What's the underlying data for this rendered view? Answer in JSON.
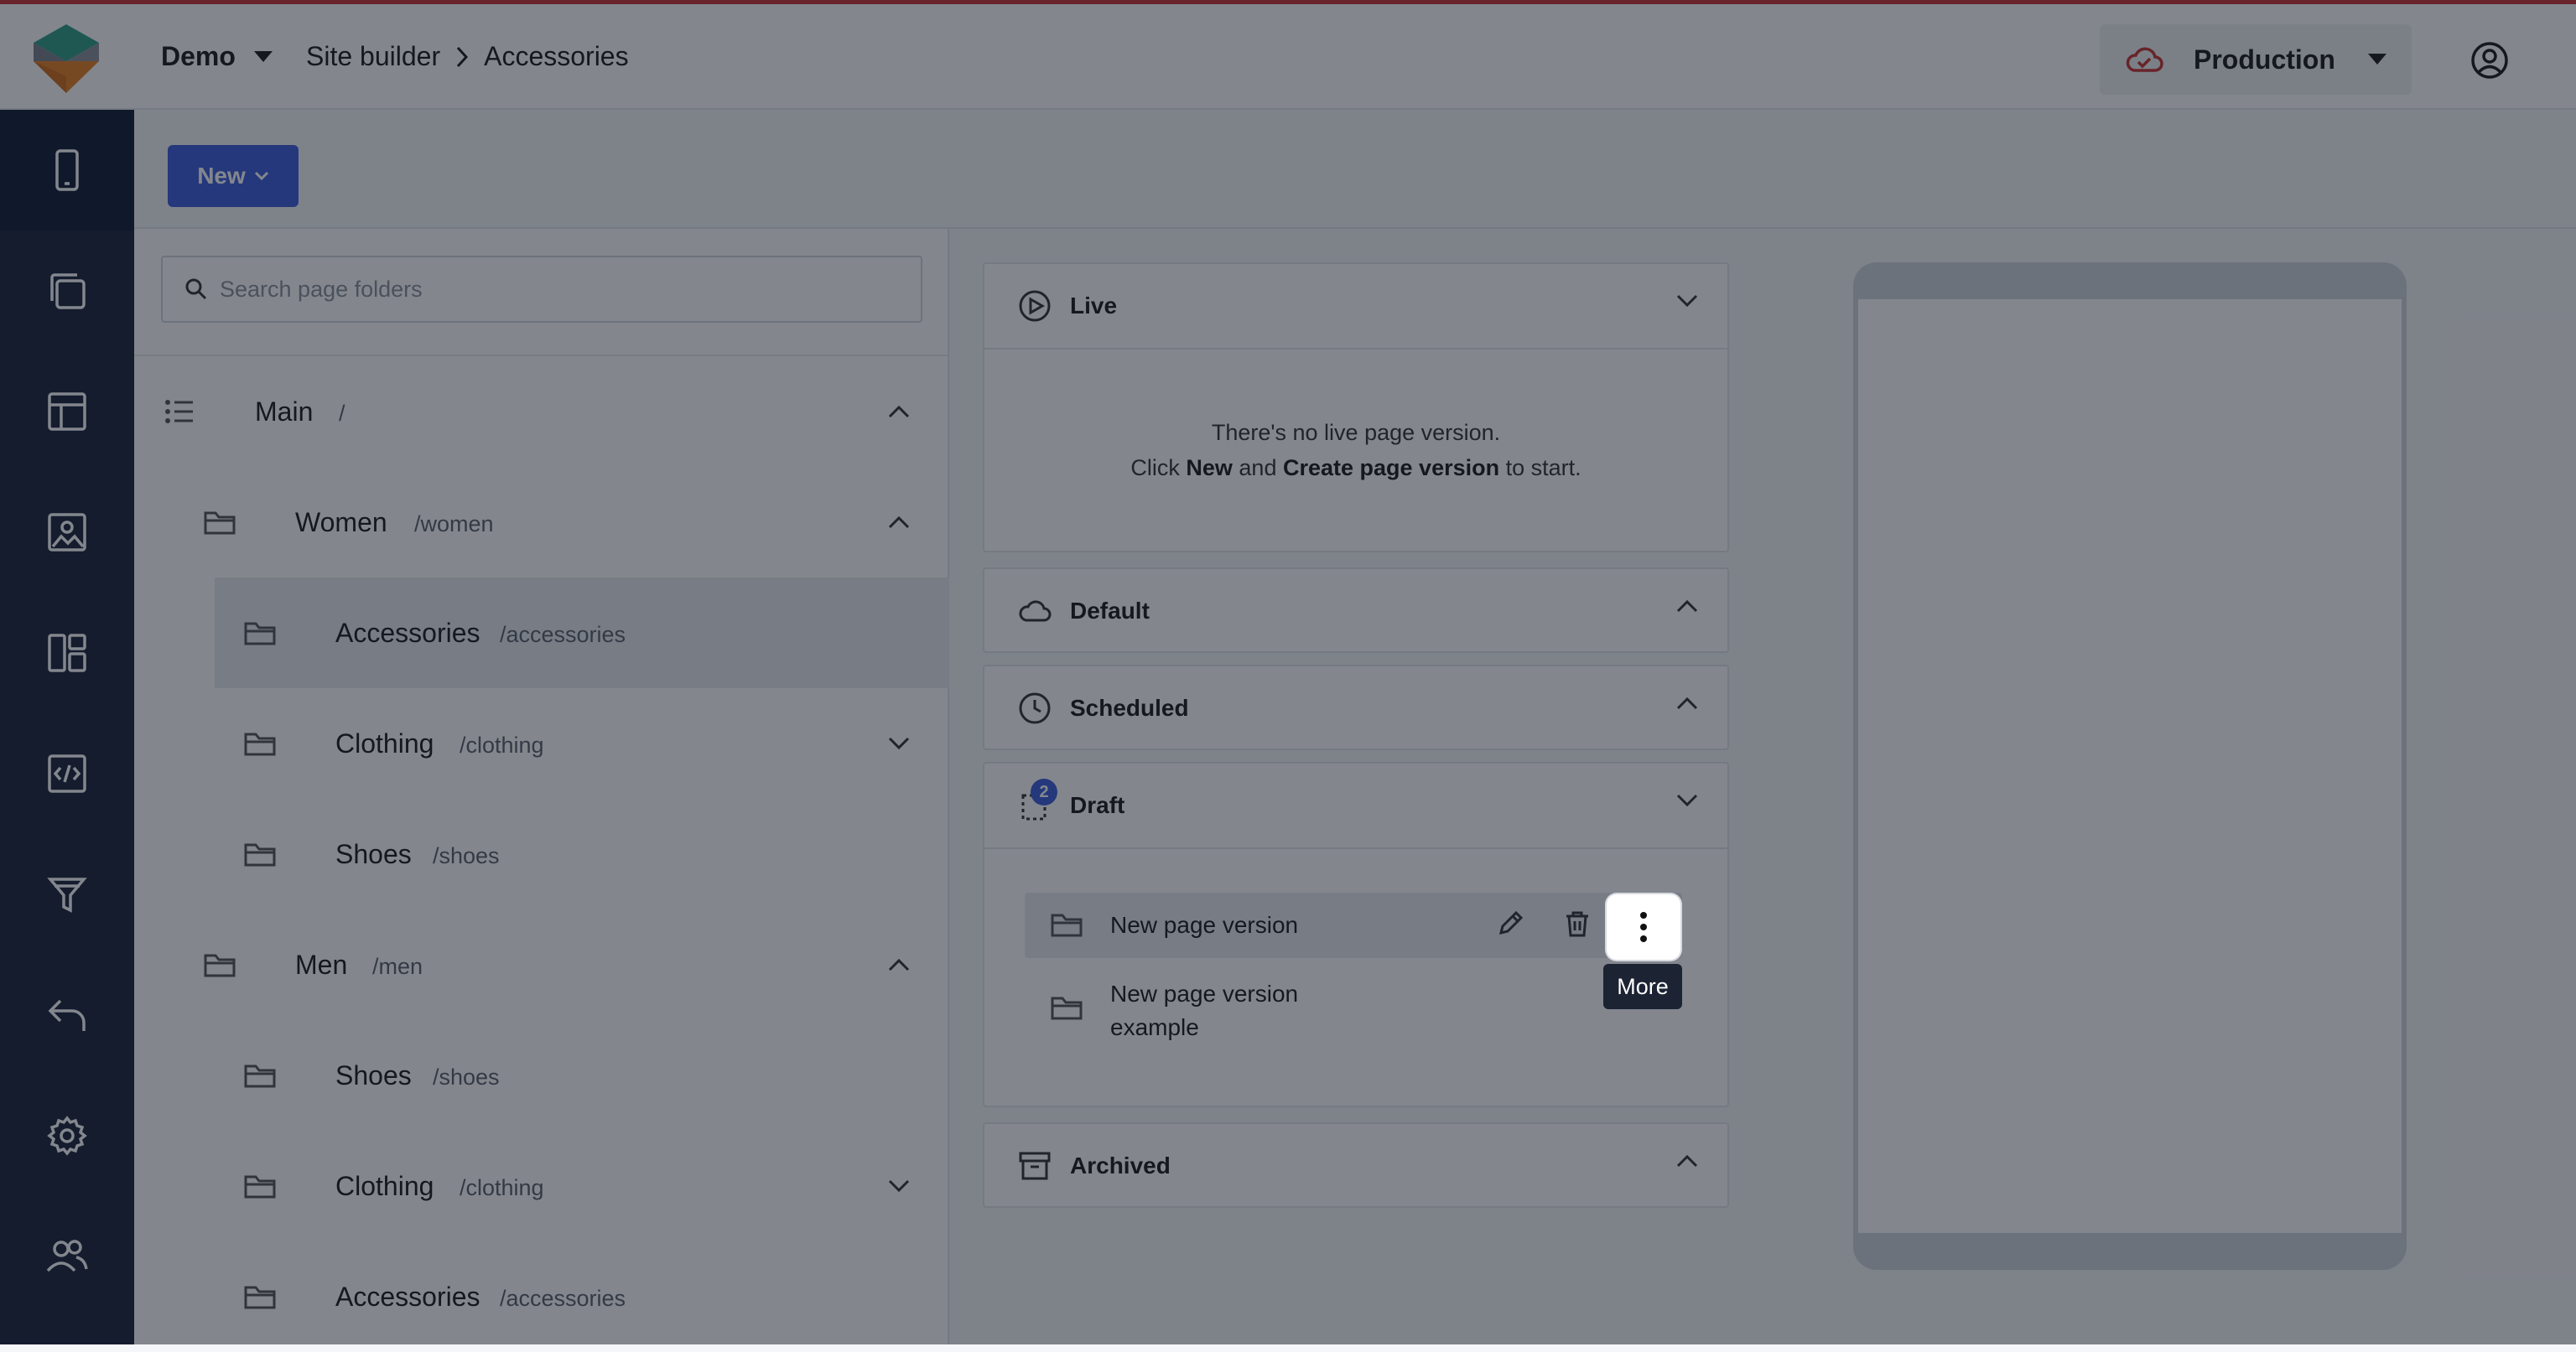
{
  "header": {
    "workspace": "Demo",
    "breadcrumb": [
      "Site builder",
      "Accessories"
    ],
    "environment": "Production"
  },
  "toolbar": {
    "new_label": "New"
  },
  "sidebar_nav": [
    "device-icon",
    "pages-icon",
    "layout-icon",
    "image-icon",
    "components-icon",
    "code-icon",
    "filter-icon",
    "return-icon",
    "gear-icon",
    "users-icon"
  ],
  "folders": {
    "search_placeholder": "Search page folders",
    "items": [
      {
        "name": "Main",
        "slug": "/",
        "level": 0,
        "expanded": true
      },
      {
        "name": "Women",
        "slug": "/women",
        "level": 1,
        "expanded": true
      },
      {
        "name": "Accessories",
        "slug": "/accessories",
        "level": 2,
        "selected": true
      },
      {
        "name": "Clothing",
        "slug": "/clothing",
        "level": 2,
        "expanded": false
      },
      {
        "name": "Shoes",
        "slug": "/shoes",
        "level": 2
      },
      {
        "name": "Men",
        "slug": "/men",
        "level": 1,
        "expanded": true
      },
      {
        "name": "Shoes",
        "slug": "/shoes",
        "level": 2
      },
      {
        "name": "Clothing",
        "slug": "/clothing",
        "level": 2,
        "expanded": false
      },
      {
        "name": "Accessories",
        "slug": "/accessories",
        "level": 2
      }
    ]
  },
  "versions": {
    "live": {
      "title": "Live",
      "empty_line1": "There's no live page version.",
      "empty_click": "Click",
      "empty_new": "New",
      "empty_and": "and",
      "empty_create": "Create page version",
      "empty_tail": "to start."
    },
    "default": {
      "title": "Default"
    },
    "scheduled": {
      "title": "Scheduled"
    },
    "draft": {
      "title": "Draft",
      "count": "2",
      "items": [
        "New page version",
        "New page version example"
      ],
      "second_line1": "New page version",
      "second_line2": "example"
    },
    "archived": {
      "title": "Archived"
    }
  },
  "tooltip": {
    "more": "More"
  },
  "colors": {
    "nav_bg": "#17213a",
    "primary": "#3b5bdb",
    "env_cloud": "#c63131"
  }
}
